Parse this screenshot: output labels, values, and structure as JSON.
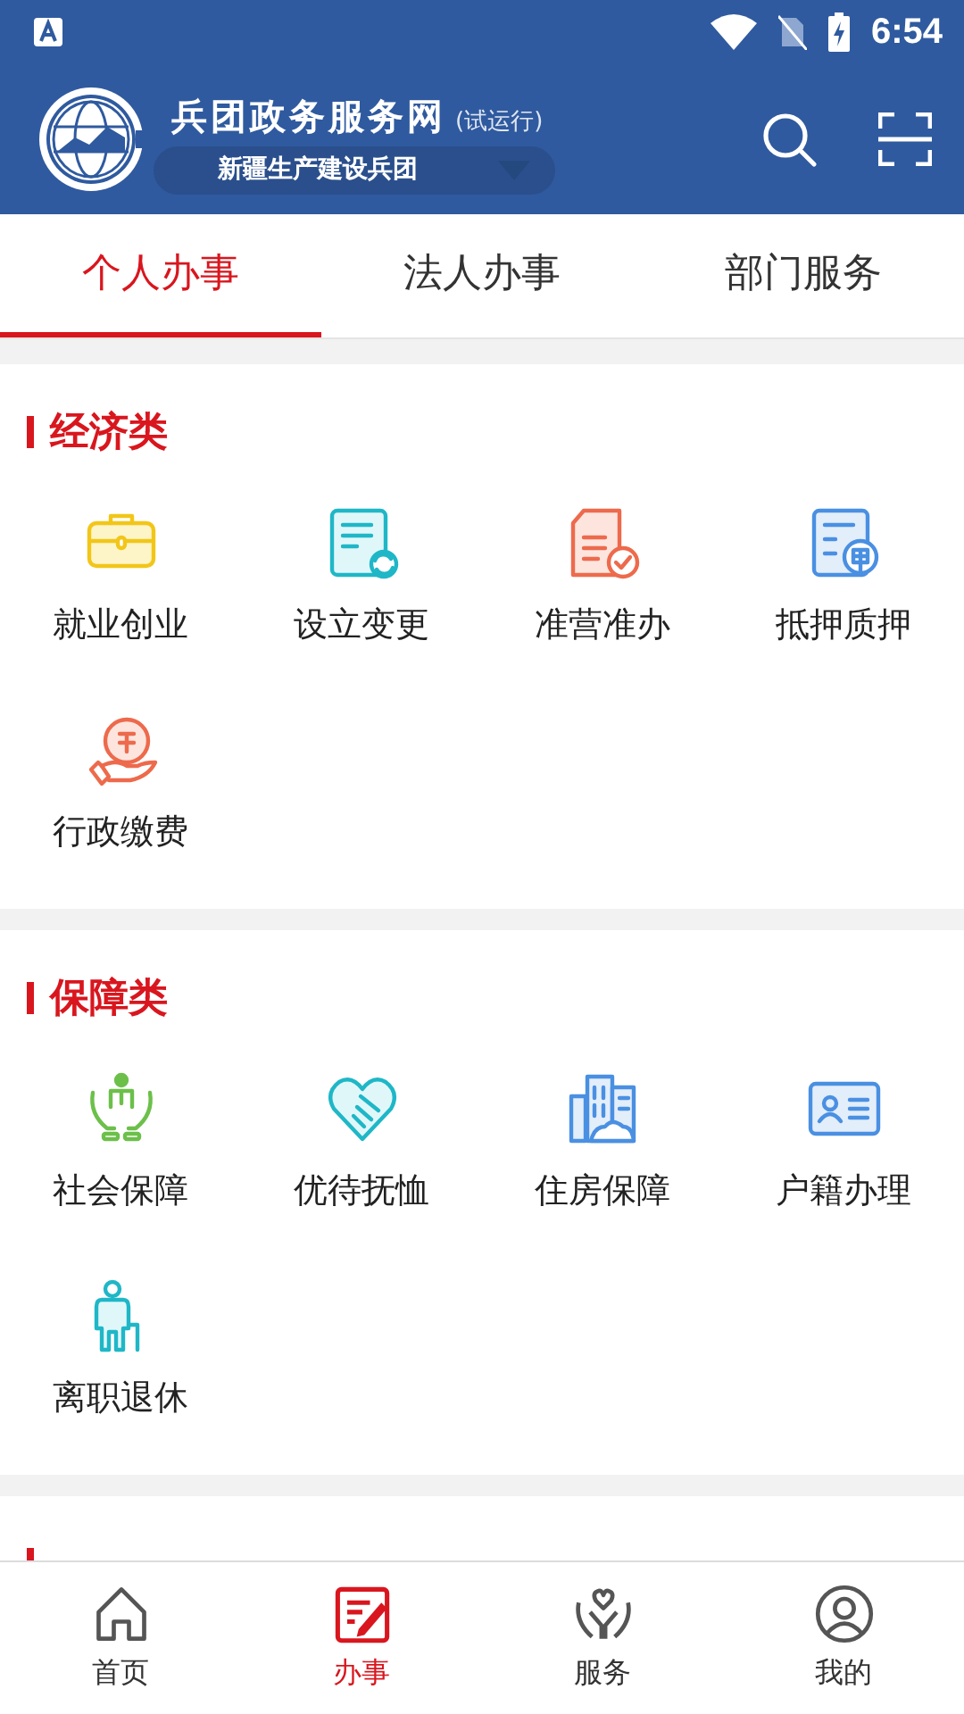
{
  "status_bar": {
    "time": "6:54"
  },
  "header": {
    "title": "兵团政务服务网",
    "title_note": "(试运行)",
    "region": "新疆生产建设兵团"
  },
  "tabs": [
    {
      "label": "个人办事",
      "selected": true
    },
    {
      "label": "法人办事",
      "selected": false
    },
    {
      "label": "部门服务",
      "selected": false
    }
  ],
  "sections": [
    {
      "title": "经济类",
      "items": [
        "就业创业",
        "设立变更",
        "准营准办",
        "抵押质押",
        "行政缴费"
      ]
    },
    {
      "title": "保障类",
      "items": [
        "社会保障",
        "优待抚恤",
        "住房保障",
        "户籍办理",
        "离职退休"
      ]
    }
  ],
  "bottom_nav": [
    {
      "label": "首页",
      "selected": false
    },
    {
      "label": "办事",
      "selected": true
    },
    {
      "label": "服务",
      "selected": false
    },
    {
      "label": "我的",
      "selected": false
    }
  ]
}
